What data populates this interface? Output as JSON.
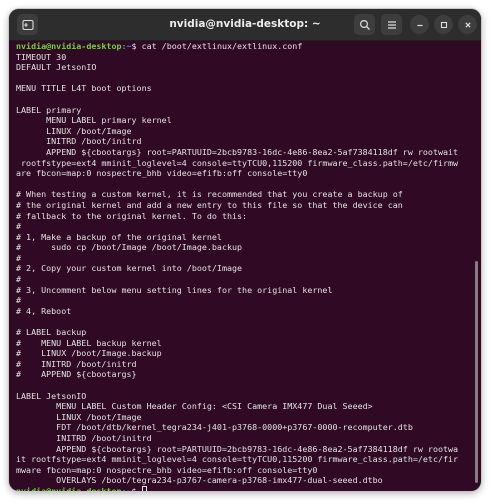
{
  "window": {
    "title": "nvidia@nvidia-desktop: ~"
  },
  "icons": {
    "new_tab": "new-tab-icon",
    "search": "search-icon",
    "menu": "hamburger-menu-icon",
    "minimize": "minimize-icon",
    "maximize": "maximize-icon",
    "close": "close-icon"
  },
  "prompt": {
    "user_host": "nvidia@nvidia-desktop",
    "path": ":~",
    "symbol": "$ "
  },
  "commands": {
    "first": "cat /boot/extlinux/extlinux.conf"
  },
  "output": [
    "TIMEOUT 30",
    "DEFAULT JetsonIO",
    "",
    "MENU TITLE L4T boot options",
    "",
    "LABEL primary",
    "      MENU LABEL primary kernel",
    "      LINUX /boot/Image",
    "      INITRD /boot/initrd",
    "      APPEND ${cbootargs} root=PARTUUID=2bcb9783-16dc-4e86-8ea2-5af7384118df rw rootwait",
    " rootfstype=ext4 mminit_loglevel=4 console=ttyTCU0,115200 firmware_class.path=/etc/firmw",
    "are fbcon=map:0 nospectre_bhb video=efifb:off console=tty0",
    "",
    "# When testing a custom kernel, it is recommended that you create a backup of",
    "# the original kernel and add a new entry to this file so that the device can",
    "# fallback to the original kernel. To do this:",
    "#",
    "# 1, Make a backup of the original kernel",
    "#      sudo cp /boot/Image /boot/Image.backup",
    "#",
    "# 2, Copy your custom kernel into /boot/Image",
    "#",
    "# 3, Uncomment below menu setting lines for the original kernel",
    "#",
    "# 4, Reboot",
    "",
    "# LABEL backup",
    "#    MENU LABEL backup kernel",
    "#    LINUX /boot/Image.backup",
    "#    INITRD /boot/initrd",
    "#    APPEND ${cbootargs}",
    "",
    "LABEL JetsonIO",
    "        MENU LABEL Custom Header Config: <CSI Camera IMX477 Dual Seeed>",
    "        LINUX /boot/Image",
    "        FDT /boot/dtb/kernel_tegra234-j401-p3768-0000+p3767-0000-recomputer.dtb",
    "        INITRD /boot/initrd",
    "        APPEND ${cbootargs} root=PARTUUID=2bcb9783-16dc-4e86-8ea2-5af7384118df rw rootwa",
    "it rootfstype=ext4 mminit_loglevel=4 console=ttyTCU0,115200 firmware_class.path=/etc/fir",
    "mware fbcon=map:0 nospectre_bhb video=efifb:off console=tty0",
    "        OVERLAYS /boot/tegra234-p3767-camera-p3768-imx477-dual-seeed.dtbo"
  ],
  "colors": {
    "terminal_bg": "#300a24",
    "titlebar_bg": "#2d2d2d",
    "text": "#e2e2e2",
    "prompt_user": "#6fd536",
    "prompt_path": "#5b8fd6"
  }
}
